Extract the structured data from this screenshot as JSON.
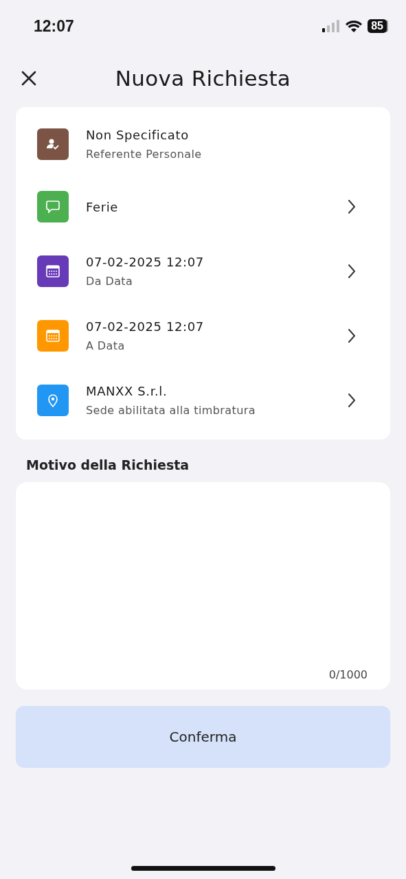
{
  "status_bar": {
    "time": "12:07",
    "battery": "85"
  },
  "header": {
    "title": "Nuova Richiesta"
  },
  "items": [
    {
      "kind": "person",
      "color": "#7b5446",
      "title": "Non Specificato",
      "subtitle": "Referente Personale",
      "chevron": false
    },
    {
      "kind": "chat",
      "color": "#4caf50",
      "title": "Ferie",
      "chevron": true
    },
    {
      "kind": "calendar",
      "color": "#673ab7",
      "title": "07-02-2025 12:07",
      "subtitle": "Da Data",
      "chevron": true
    },
    {
      "kind": "calendar",
      "color": "#ff9800",
      "title": "07-02-2025 12:07",
      "subtitle": "A Data",
      "chevron": true
    },
    {
      "kind": "pin",
      "color": "#2196f3",
      "title": "MANXX S.r.l.",
      "subtitle": "Sede abilitata alla timbratura",
      "chevron": true
    }
  ],
  "reason": {
    "label": "Motivo della Richiesta",
    "counter": "0/1000"
  },
  "confirm_button": "Conferma"
}
